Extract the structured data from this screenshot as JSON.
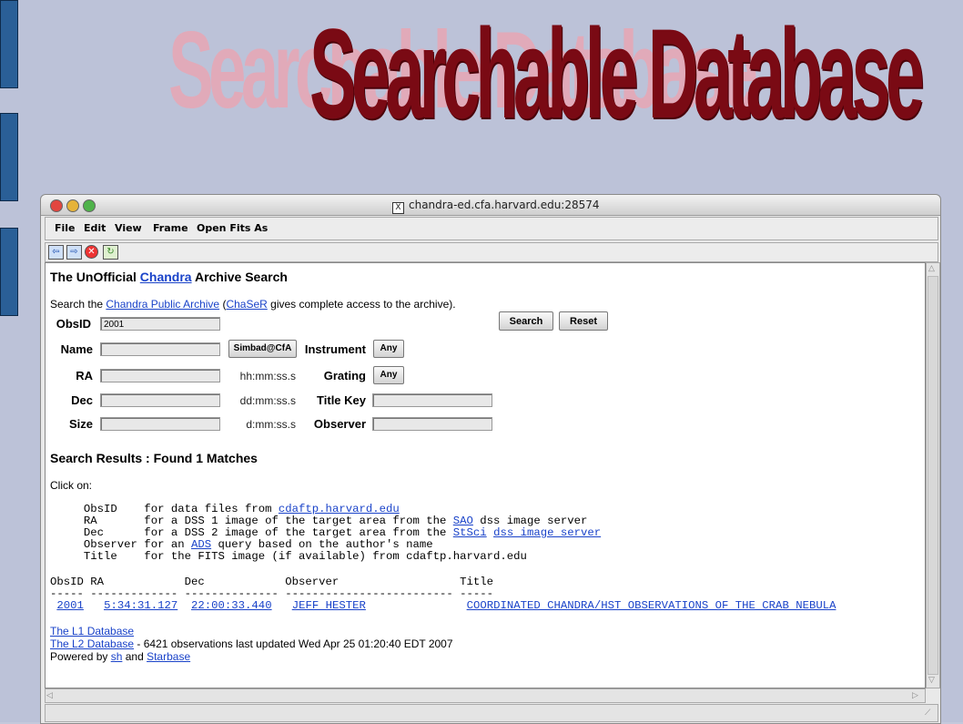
{
  "slide": {
    "title": "Searchable Database"
  },
  "window": {
    "title": "chandra-ed.cfa.harvard.edu:28574",
    "menu": [
      "File",
      "Edit",
      "View",
      "Frame",
      "Open Fits As"
    ]
  },
  "page": {
    "heading_pre": "The UnOfficial ",
    "heading_link": "Chandra",
    "heading_post": " Archive Search",
    "intro_pre": "Search the ",
    "intro_link1": "Chandra Public Archive",
    "intro_mid": " (",
    "intro_link2": "ChaSeR",
    "intro_post": " gives complete access to the archive).",
    "form": {
      "obsid_label": "ObsID",
      "obsid_value": "2001",
      "name_label": "Name",
      "ra_label": "RA",
      "dec_label": "Dec",
      "size_label": "Size",
      "simbad_button": "Simbad@CfA",
      "ra_hint": "hh:mm:ss.s",
      "dec_hint": "dd:mm:ss.s",
      "size_hint": "d:mm:ss.s",
      "instrument_label": "Instrument",
      "grating_label": "Grating",
      "titlekey_label": "Title Key",
      "observer_label": "Observer",
      "instrument_value": "Any",
      "grating_value": "Any",
      "search_button": "Search",
      "reset_button": "Reset"
    },
    "results_heading": "Search Results : Found 1 Matches",
    "click_on": "Click on:",
    "legend": {
      "l1_pre": "     ObsID    for data files from ",
      "l1_link": "cdaftp.harvard.edu",
      "l2_pre": "     RA       for a DSS 1 image of the target area from the ",
      "l2_link": "SAO",
      "l2_post": " dss image server",
      "l3_pre": "     Dec      for a DSS 2 image of the target area from the ",
      "l3_link1": "StSci",
      "l3_link2": "dss image server",
      "l4_pre": "     Observer for an ",
      "l4_link": "ADS",
      "l4_post": " query based on the author's name",
      "l5": "     Title    for the FITS image (if available) from cdaftp.harvard.edu"
    },
    "table": {
      "header": "ObsID RA            Dec            Observer                  Title",
      "rule": "----- ------------- -------------- ------------------------- -----",
      "row": {
        "obsid": "2001",
        "ra": "5:34:31.127",
        "dec": "22:00:33.440",
        "observer": "JEFF HESTER",
        "title": "COORDINATED CHANDRA/HST OBSERVATIONS OF THE CRAB NEBULA"
      }
    },
    "footer": {
      "l1_link": "The L1 Database",
      "l2_link": "The L2 Database",
      "l2_post": " - 6421 observations last updated Wed Apr 25 01:20:40 EDT 2007",
      "powered_pre": "Powered by ",
      "powered_link1": "sh",
      "powered_mid": " and ",
      "powered_link2": "Starbase"
    }
  }
}
